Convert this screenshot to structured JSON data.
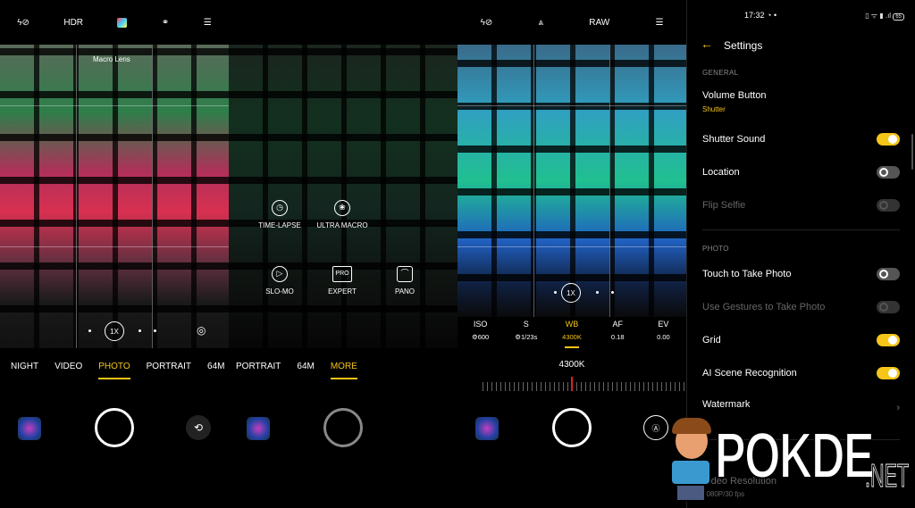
{
  "panel1": {
    "top_icons": [
      "flash-auto-icon",
      "HDR",
      "filter-icon",
      "beauty-icon",
      "menu-icon"
    ],
    "hdr": "HDR",
    "lens_label": "Macro Lens",
    "zoom": "1X",
    "modes": [
      "NIGHT",
      "VIDEO",
      "PHOTO",
      "PORTRAIT",
      "64M"
    ],
    "active_mode": "PHOTO"
  },
  "panel2": {
    "modes": [
      "PORTRAIT",
      "64M",
      "MORE"
    ],
    "active_mode": "MORE",
    "more_items": [
      {
        "label": "TIME-LAPSE",
        "icon": "timelapse-icon"
      },
      {
        "label": "ULTRA MACRO",
        "icon": "macro-icon"
      },
      {
        "label": "SLO-MO",
        "icon": "slomo-icon"
      },
      {
        "label": "EXPERT",
        "icon": "pro-icon",
        "badge": "PRO"
      },
      {
        "label": "PANO",
        "icon": "pano-icon"
      }
    ]
  },
  "panel3": {
    "raw": "RAW",
    "zoom": "1X",
    "params": [
      {
        "name": "ISO",
        "value": "600"
      },
      {
        "name": "S",
        "value": "1/23s"
      },
      {
        "name": "WB",
        "value": "4300K"
      },
      {
        "name": "AF",
        "value": "0.18"
      },
      {
        "name": "EV",
        "value": "0.00"
      }
    ],
    "active_param": "WB",
    "wb_readout": "4300K"
  },
  "panel4": {
    "time": "17:32",
    "battery": "65",
    "title": "Settings",
    "sections": [
      {
        "header": "GENERAL",
        "items": [
          {
            "label": "Volume Button",
            "sub": "Shutter"
          },
          {
            "label": "Shutter Sound",
            "toggle": true
          },
          {
            "label": "Location",
            "toggle": false
          },
          {
            "label": "Flip Selfie",
            "toggle": false,
            "disabled": true
          }
        ]
      },
      {
        "header": "PHOTO",
        "items": [
          {
            "label": "Touch to Take Photo",
            "toggle": false
          },
          {
            "label": "Use Gestures to Take Photo",
            "toggle": false,
            "disabled": true
          },
          {
            "label": "Grid",
            "toggle": true
          },
          {
            "label": "AI Scene Recognition",
            "toggle": true
          },
          {
            "label": "Watermark"
          },
          {
            "label": "Video Resolution",
            "sub": "1080P/30 fps"
          }
        ]
      }
    ]
  },
  "watermark": {
    "brand": "POKDE",
    "tld": ".NET"
  },
  "colors": {
    "accent": "#f5c518",
    "wb_marker": "#e02020"
  }
}
